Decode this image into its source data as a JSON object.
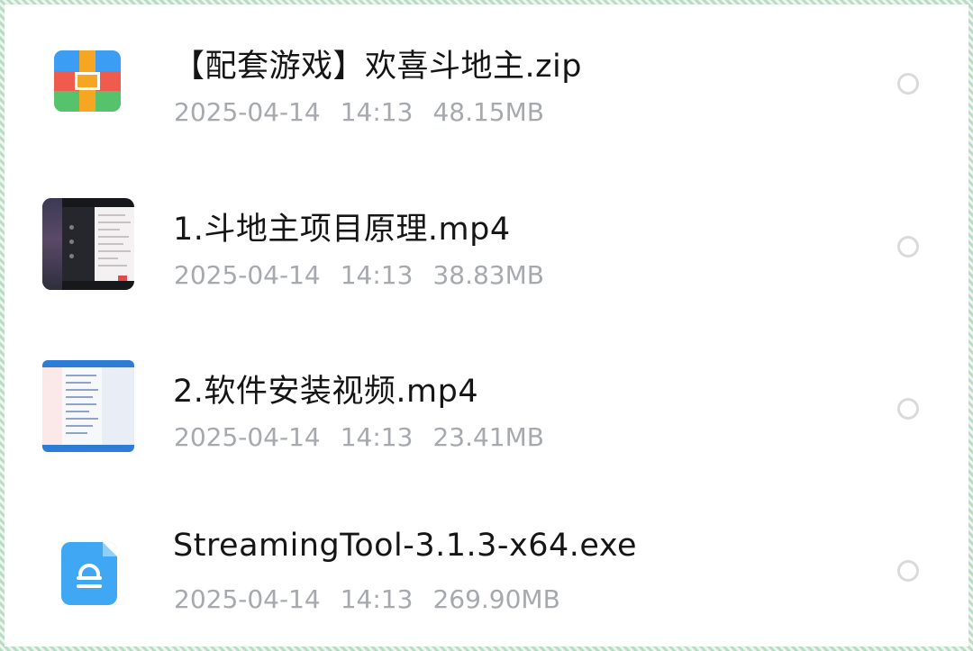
{
  "files": [
    {
      "name": "【配套游戏】欢喜斗地主.zip",
      "date": "2025-04-14",
      "time": "14:13",
      "size": "48.15MB",
      "icon": "zip-archive-icon"
    },
    {
      "name": "1.斗地主项目原理.mp4",
      "date": "2025-04-14",
      "time": "14:13",
      "size": "38.83MB",
      "icon": "video-thumbnail"
    },
    {
      "name": "2.软件安装视频.mp4",
      "date": "2025-04-14",
      "time": "14:13",
      "size": "23.41MB",
      "icon": "video-thumbnail"
    },
    {
      "name": "StreamingTool-3.1.3-x64.exe",
      "date": "2025-04-14",
      "time": "14:13",
      "size": "269.90MB",
      "icon": "exe-file-icon"
    }
  ],
  "colors": {
    "name_text": "#151515",
    "meta_text": "#a6a9ad",
    "radio_border": "#dadada"
  }
}
